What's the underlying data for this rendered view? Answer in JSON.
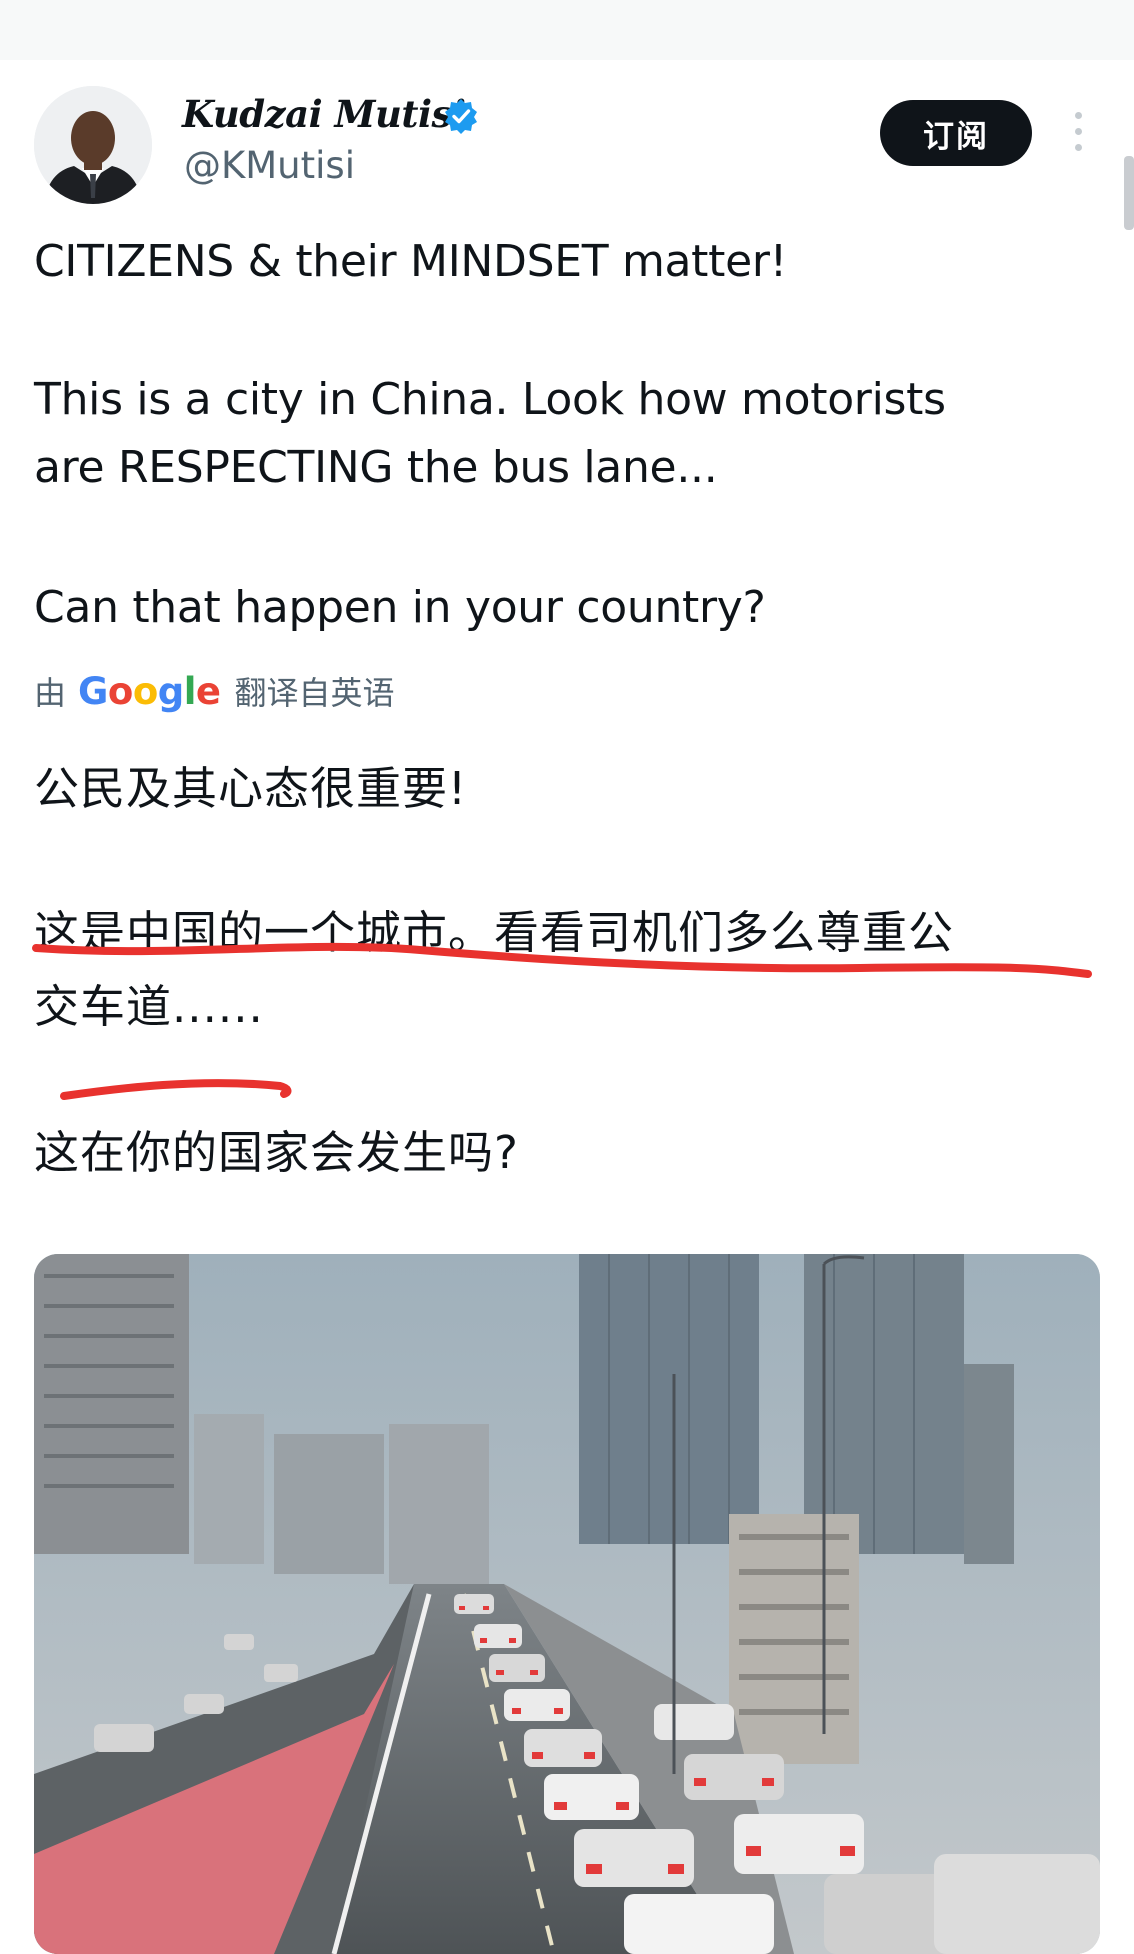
{
  "author": {
    "name": "Kudzai Mutisi",
    "handle": "@KMutisi",
    "verified": true,
    "verified_color": "#1d9bf0"
  },
  "actions": {
    "subscribe_label": "订阅",
    "more_icon": "more-vertical-icon"
  },
  "tweet": {
    "lines": [
      "CITIZENS & their MINDSET matter!",
      "This is a city in China. Look how motorists",
      "are RESPECTING the bus lane...",
      "Can that happen in your country?"
    ]
  },
  "translation": {
    "by": "由",
    "provider": "Google",
    "suffix": "翻译自英语",
    "lines": [
      "公民及其心态很重要!",
      "这是中国的一个城市。看看司机们多么尊重公",
      "交车道......",
      "这在你的国家会发生吗?"
    ]
  },
  "annotations": {
    "underline_color": "#e8322e"
  },
  "media": {
    "type": "photo",
    "subject": "city-traffic-bus-lane"
  }
}
